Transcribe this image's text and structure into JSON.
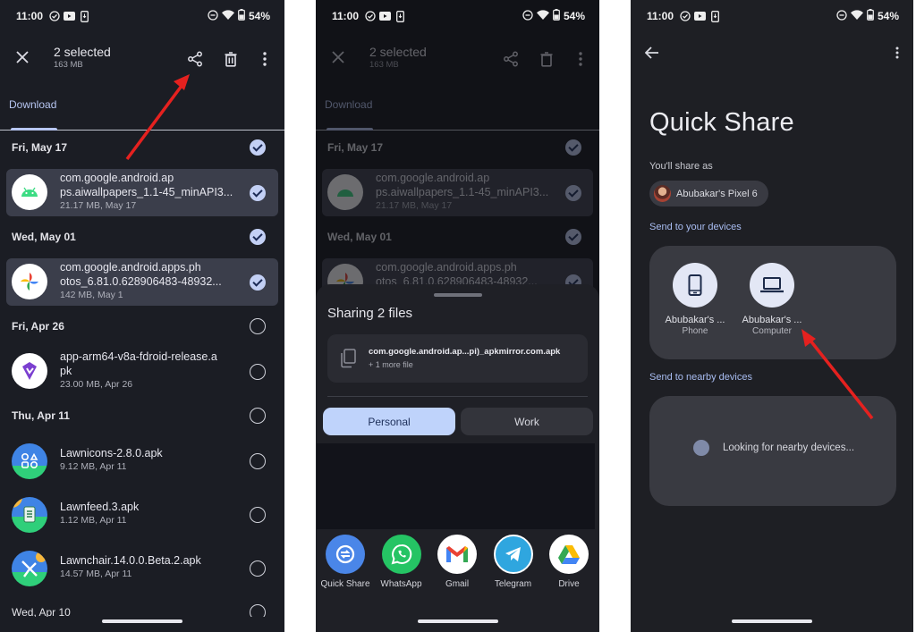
{
  "status_bar": {
    "time": "11:00",
    "battery": "54%",
    "left_icons": [
      "check-circle-icon",
      "youtube-icon",
      "phone-download-icon"
    ],
    "right_icons": [
      "dnd-icon",
      "wifi-icon",
      "battery-icon"
    ]
  },
  "files_screen": {
    "selection_title": "2 selected",
    "selection_size": "163 MB",
    "actions": [
      "share-icon",
      "delete-icon",
      "more-vert-icon"
    ],
    "tab": "Download",
    "groups": [
      {
        "date": "Fri, May 17",
        "checked": true,
        "files": [
          {
            "name_line1": "com.google.android.ap",
            "name_line2": "ps.aiwallpapers_1.1-45_minAPI3...",
            "meta": "21.17 MB, May 17",
            "selected": true,
            "icon": "android-icon"
          }
        ]
      },
      {
        "date": "Wed, May 01",
        "checked": true,
        "files": [
          {
            "name_line1": "com.google.android.apps.ph",
            "name_line2": "otos_6.81.0.628906483-48932...",
            "meta": "142 MB, May 1",
            "selected": true,
            "icon": "google-photos-icon"
          }
        ]
      },
      {
        "date": "Fri, Apr 26",
        "checked": false,
        "files": [
          {
            "name_line1": "app-arm64-v8a-fdroid-release.a",
            "name_line2": "pk",
            "meta": "23.00 MB, Apr 26",
            "selected": false,
            "icon": "fdroid-app-icon"
          }
        ]
      },
      {
        "date": "Thu, Apr 11",
        "checked": false,
        "files": [
          {
            "name_line1": "Lawnicons-2.8.0.apk",
            "name_line2": "",
            "meta": "9.12 MB, Apr 11",
            "selected": false,
            "icon": "lawnicons-icon"
          },
          {
            "name_line1": "Lawnfeed.3.apk",
            "name_line2": "",
            "meta": "1.12 MB, Apr 11",
            "selected": false,
            "icon": "lawnfeed-icon"
          },
          {
            "name_line1": "Lawnchair.14.0.0.Beta.2.apk",
            "name_line2": "",
            "meta": "14.57 MB, Apr 11",
            "selected": false,
            "icon": "lawnchair-icon"
          }
        ]
      },
      {
        "date": "Wed, Apr 10",
        "checked": false,
        "files": []
      }
    ]
  },
  "share_sheet": {
    "title": "Sharing 2 files",
    "file_name": "com.google.android.ap...pi)_apkmirror.com.apk",
    "more_files": "+ 1 more file",
    "profile_tabs": [
      {
        "label": "Personal",
        "active": true
      },
      {
        "label": "Work",
        "active": false
      }
    ],
    "targets": [
      {
        "label": "Quick Share",
        "icon": "quick-share-icon",
        "color": "#4a86e8"
      },
      {
        "label": "WhatsApp",
        "icon": "whatsapp-icon",
        "color": "#25c464"
      },
      {
        "label": "Gmail",
        "icon": "gmail-icon",
        "color": "#ffffff"
      },
      {
        "label": "Telegram",
        "icon": "telegram-icon",
        "color": "#2fa6df"
      },
      {
        "label": "Drive",
        "icon": "google-drive-icon",
        "color": "#ffffff"
      }
    ]
  },
  "quick_share": {
    "title": "Quick Share",
    "share_as_label": "You'll share as",
    "device_name": "Abubakar's Pixel 6",
    "your_devices_label": "Send to your devices",
    "devices": [
      {
        "name": "Abubakar's ...",
        "type": "Phone",
        "icon": "phone-icon"
      },
      {
        "name": "Abubakar's ...",
        "type": "Computer",
        "icon": "laptop-icon"
      }
    ],
    "nearby_label": "Send to nearby devices",
    "looking_text": "Looking for nearby devices..."
  },
  "colors": {
    "accent": "#b7c6f2",
    "selected_row": "#3b3e4b",
    "annotation_arrow": "#e5211f"
  }
}
